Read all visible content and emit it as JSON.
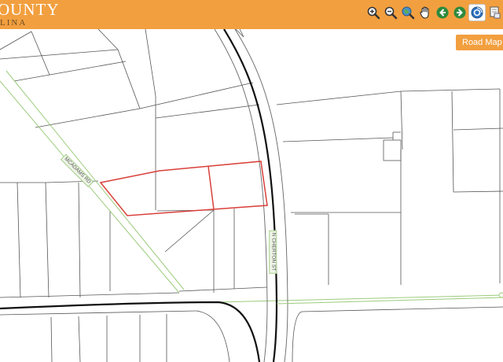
{
  "header": {
    "brand_line1": "OUNTY",
    "brand_line2": "LINA",
    "bg_color": "#f29f3f"
  },
  "toolbar": {
    "tools": [
      {
        "icon": "zoom-in-icon"
      },
      {
        "icon": "zoom-out-icon"
      },
      {
        "icon": "globe-icon"
      },
      {
        "icon": "pan-hand-icon"
      },
      {
        "icon": "back-arrow-icon"
      },
      {
        "icon": "forward-arrow-icon"
      },
      {
        "icon": "identify-icon",
        "active": true
      },
      {
        "icon": "print-icon"
      }
    ]
  },
  "map": {
    "road_map_button": "Road Map",
    "road_labels": {
      "diagonal_road": "MCADAMS RD",
      "vertical_street": "N CHERTON ST"
    },
    "colors": {
      "parcel_line": "#555555",
      "highlight": "#d9403a",
      "road_centerline": "#111111",
      "minor_road": "#9ccc7c"
    }
  }
}
